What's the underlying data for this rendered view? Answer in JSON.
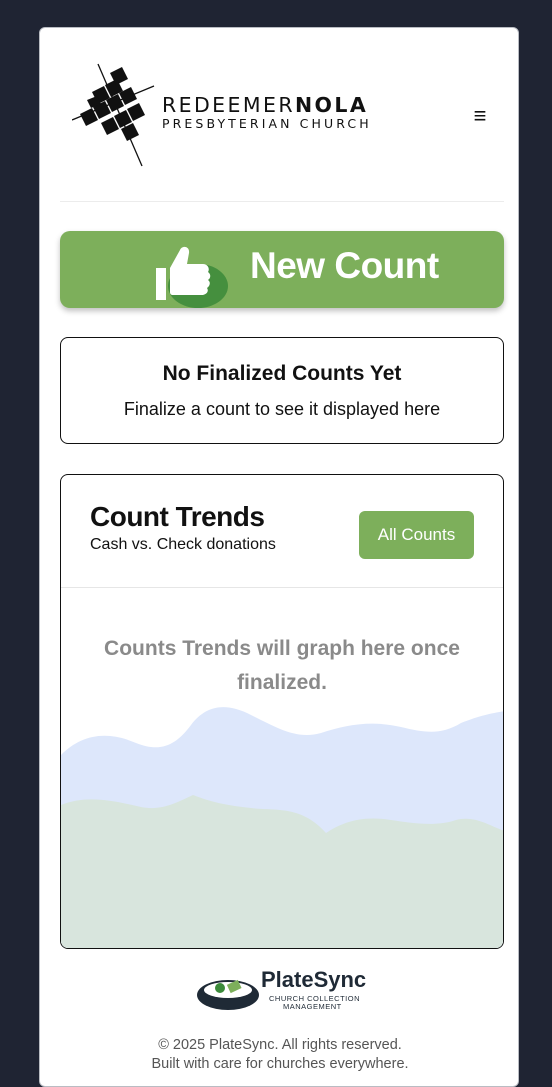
{
  "header": {
    "logo_word_light": "REDEEMER",
    "logo_word_bold": "NOLA",
    "logo_subtitle": "PRESBYTERIAN CHURCH",
    "menu_icon": "≡"
  },
  "new_count": {
    "label": "New Count",
    "icon": "thumbs-up-icon",
    "color": "#7daf5b"
  },
  "empty_state": {
    "title": "No Finalized Counts Yet",
    "subtitle": "Finalize a count to see it displayed here"
  },
  "trends": {
    "title": "Count Trends",
    "subtitle": "Cash vs. Check donations",
    "all_counts_label": "All Counts",
    "placeholder": "Counts Trends will graph here once finalized.",
    "wave_colors": {
      "cash": "#dde7fb",
      "check": "#d8e5dd"
    }
  },
  "footer": {
    "brand_name": "PlateSync",
    "brand_tagline_1": "CHURCH COLLECTION",
    "brand_tagline_2": "MANAGEMENT",
    "copyright": "© 2025 PlateSync. All rights reserved.",
    "tagline": "Built with care for churches everywhere."
  }
}
